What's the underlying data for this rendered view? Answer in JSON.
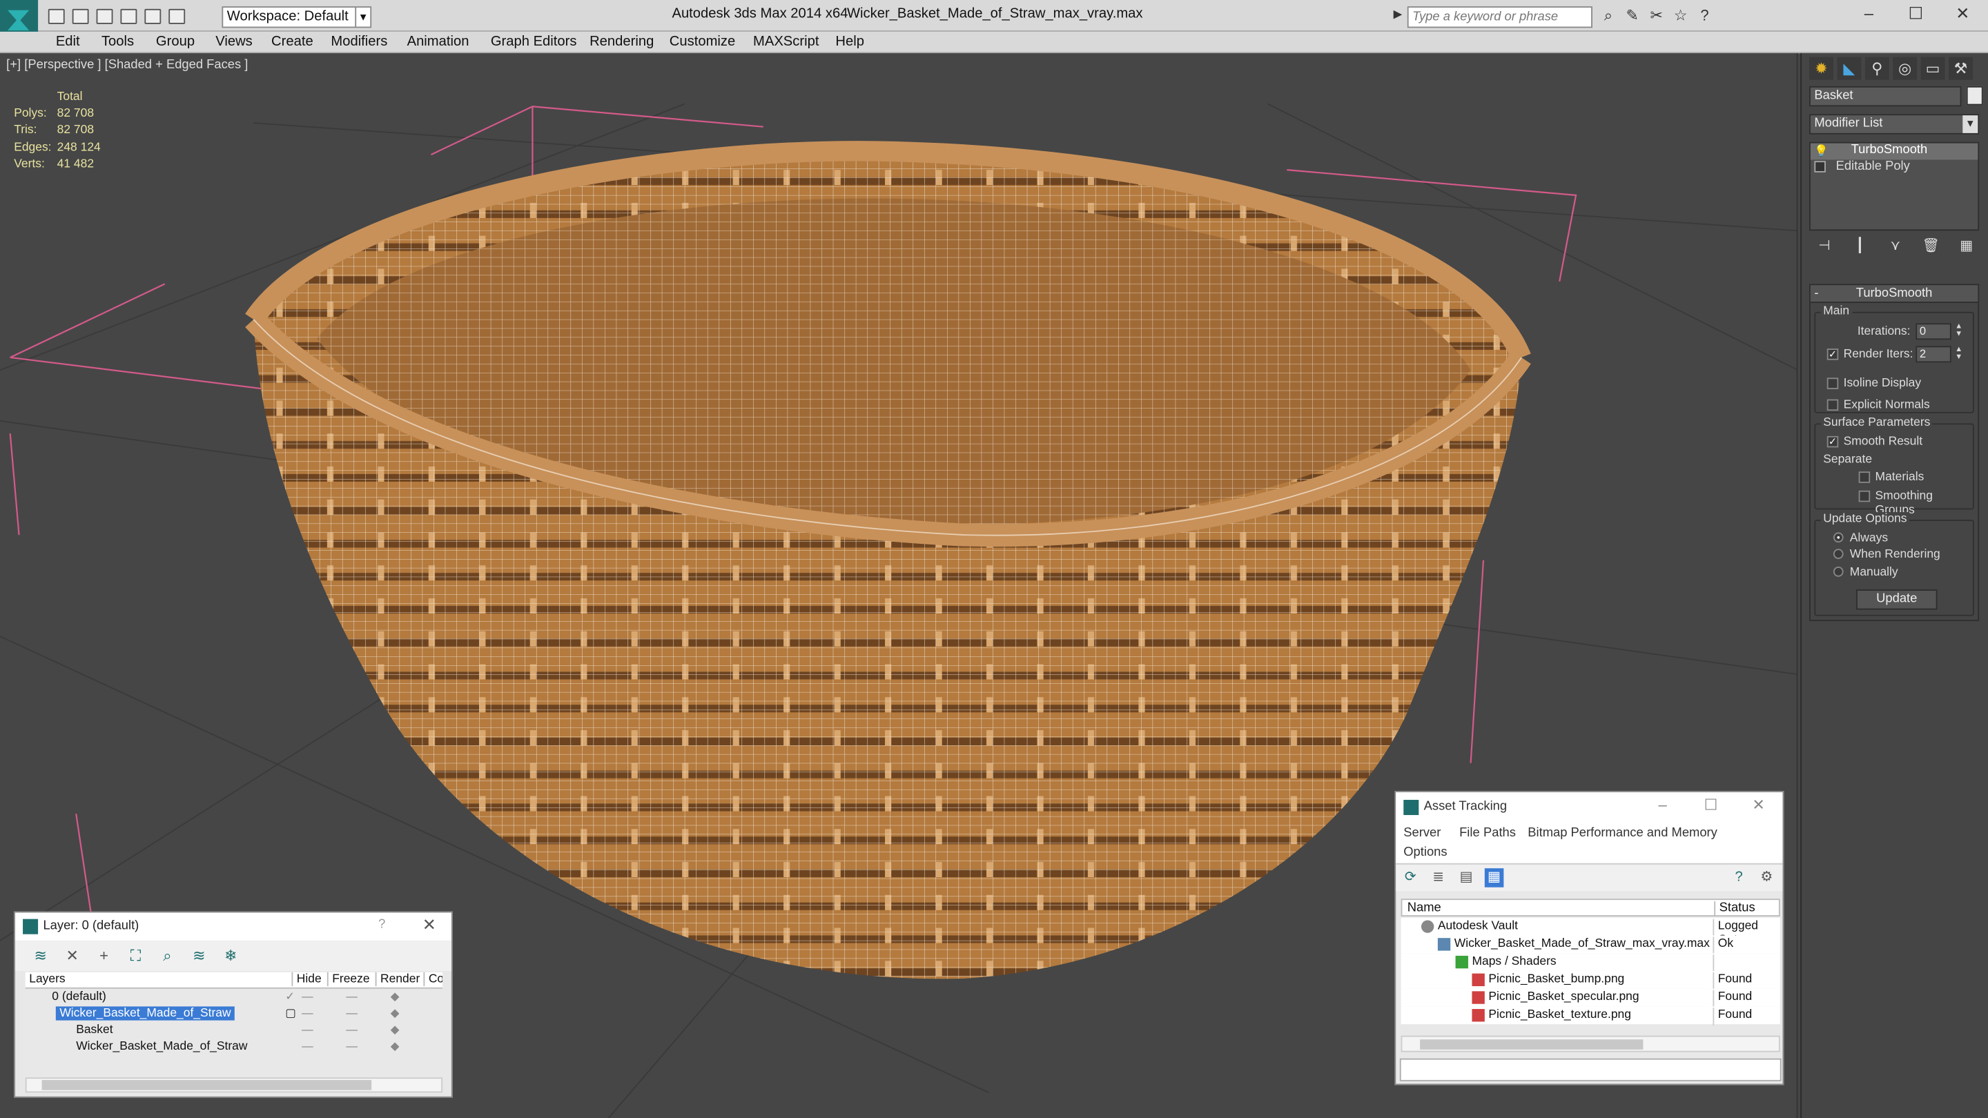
{
  "titlebar": {
    "app_title": "Autodesk 3ds Max  2014 x64",
    "file_title": "Wicker_Basket_Made_of_Straw_max_vray.max",
    "workspace": "Workspace: Default",
    "search_placeholder": "Type a keyword or phrase"
  },
  "menu": [
    "Edit",
    "Tools",
    "Group",
    "Views",
    "Create",
    "Modifiers",
    "Animation",
    "Graph Editors",
    "Rendering",
    "Customize",
    "MAXScript",
    "Help"
  ],
  "viewport": {
    "label": "[+] [Perspective ] [Shaded + Edged Faces ]",
    "stats": {
      "total_label": "Total",
      "polys_label": "Polys:",
      "polys": "82 708",
      "tris_label": "Tris:",
      "tris": "82 708",
      "edges_label": "Edges:",
      "edges": "248 124",
      "verts_label": "Verts:",
      "verts": "41 482"
    }
  },
  "command_panel": {
    "object_name": "Basket",
    "modifier_list": "Modifier List",
    "stack": [
      "TurboSmooth",
      "Editable Poly"
    ],
    "rollout_title": "TurboSmooth",
    "main_label": "Main",
    "iterations_label": "Iterations:",
    "iterations": "0",
    "render_iters_label": "Render Iters:",
    "render_iters": "2",
    "isoline_label": "Isoline Display",
    "explicit_normals_label": "Explicit Normals",
    "surface_params_label": "Surface Parameters",
    "smooth_result_label": "Smooth Result",
    "separate_label": "Separate",
    "materials_label": "Materials",
    "smoothing_groups_label": "Smoothing Groups",
    "update_options_label": "Update Options",
    "always_label": "Always",
    "when_rendering_label": "When Rendering",
    "manually_label": "Manually",
    "update_button": "Update"
  },
  "layer_window": {
    "title": "Layer: 0 (default)",
    "help": "?",
    "columns": [
      "Layers",
      "Hide",
      "Freeze",
      "Render",
      "Co"
    ],
    "rows": [
      "0 (default)",
      "Wicker_Basket_Made_of_Straw",
      "Basket",
      "Wicker_Basket_Made_of_Straw"
    ]
  },
  "asset_tracking": {
    "title": "Asset Tracking",
    "menu": [
      "Server",
      "File",
      "Paths",
      "Bitmap Performance and Memory",
      "Options"
    ],
    "col_name": "Name",
    "col_status": "Status",
    "rows": [
      {
        "name": "Autodesk Vault",
        "status": "Logged Out"
      },
      {
        "name": "Wicker_Basket_Made_of_Straw_max_vray.max",
        "status": "Ok"
      },
      {
        "name": "Maps / Shaders",
        "status": ""
      },
      {
        "name": "Picnic_Basket_bump.png",
        "status": "Found"
      },
      {
        "name": "Picnic_Basket_specular.png",
        "status": "Found"
      },
      {
        "name": "Picnic_Basket_texture.png",
        "status": "Found"
      }
    ]
  },
  "colors": {
    "accent": "#1f6e6e",
    "stats": "#e8e2a0",
    "wicker": "#b07a40",
    "selection": "#3a7bd5"
  }
}
